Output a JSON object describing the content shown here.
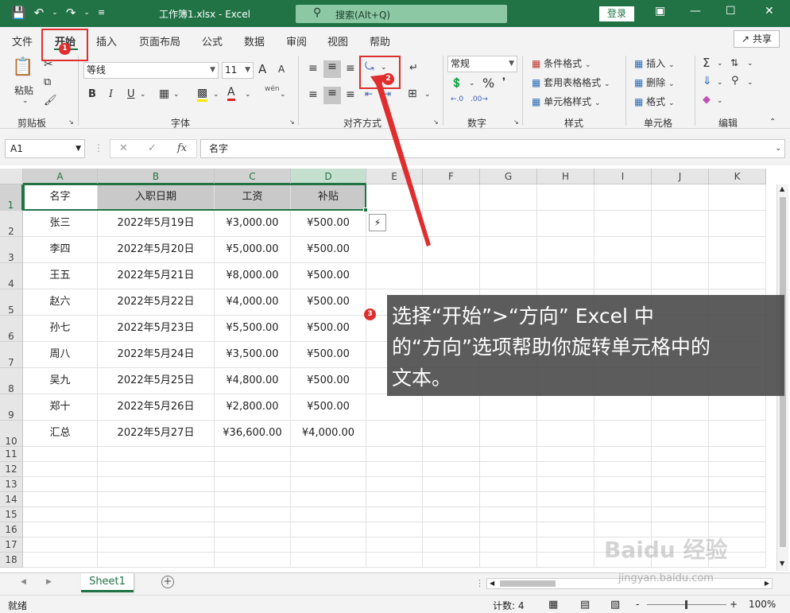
{
  "titlebar": {
    "title": "工作簿1.xlsx  -  Excel",
    "search_placeholder": "搜索(Alt+Q)",
    "login_label": "登录"
  },
  "menu": {
    "tabs": [
      "文件",
      "开始",
      "插入",
      "页面布局",
      "公式",
      "数据",
      "审阅",
      "视图",
      "帮助"
    ],
    "active_tab": "开始",
    "share_label": "共享"
  },
  "ribbon": {
    "clipboard": {
      "paste_label": "粘贴",
      "group_label": "剪贴板"
    },
    "font": {
      "font_name": "等线",
      "font_size": "11",
      "group_label": "字体",
      "bold": "B",
      "italic": "I",
      "underline": "U",
      "grow": "A",
      "shrink": "A",
      "phonetic": "wén"
    },
    "alignment": {
      "group_label": "对齐方式"
    },
    "number": {
      "format": "常规",
      "group_label": "数字"
    },
    "styles": {
      "cond_format": "条件格式",
      "table_format": "套用表格格式",
      "cell_styles": "单元格样式",
      "group_label": "样式"
    },
    "cells": {
      "insert": "插入",
      "delete": "删除",
      "format": "格式",
      "group_label": "单元格"
    },
    "editing": {
      "group_label": "编辑"
    }
  },
  "formula_bar": {
    "cell_ref": "A1",
    "fx_label": "fx",
    "content": "名字"
  },
  "grid": {
    "columns": [
      "A",
      "B",
      "C",
      "D",
      "E",
      "F",
      "G",
      "H",
      "I",
      "J",
      "K"
    ],
    "rows": [
      "1",
      "2",
      "3",
      "4",
      "5",
      "6",
      "7",
      "8",
      "9",
      "10",
      "11",
      "12",
      "13",
      "14",
      "15",
      "16",
      "17",
      "18"
    ],
    "headers": [
      "名字",
      "入职日期",
      "工资",
      "补贴"
    ],
    "data": [
      [
        "张三",
        "2022年5月19日",
        "¥3,000.00",
        "¥500.00"
      ],
      [
        "李四",
        "2022年5月20日",
        "¥5,000.00",
        "¥500.00"
      ],
      [
        "王五",
        "2022年5月21日",
        "¥8,000.00",
        "¥500.00"
      ],
      [
        "赵六",
        "2022年5月22日",
        "¥4,000.00",
        "¥500.00"
      ],
      [
        "孙七",
        "2022年5月23日",
        "¥5,500.00",
        "¥500.00"
      ],
      [
        "周八",
        "2022年5月24日",
        "¥3,500.00",
        "¥500.00"
      ],
      [
        "吴九",
        "2022年5月25日",
        "¥4,800.00",
        "¥500.00"
      ],
      [
        "郑十",
        "2022年5月26日",
        "¥2,800.00",
        "¥500.00"
      ],
      [
        "汇总",
        "2022年5月27日",
        "¥36,600.00",
        "¥4,000.00"
      ]
    ]
  },
  "annotations": {
    "badge1": "1",
    "badge2": "2",
    "badge3": "3",
    "callout_line1": "选择“开始”>“方向” Excel 中",
    "callout_line2": "的“方向”选项帮助你旋转单元格中的",
    "callout_line3": "文本。",
    "color": "#e02d2d"
  },
  "sheets": {
    "tabs": [
      "Sheet1"
    ],
    "add_label": "+"
  },
  "status": {
    "ready": "就绪",
    "count": "计数: 4",
    "zoom": "100%",
    "zoom_minus": "-",
    "zoom_plus": "+"
  },
  "watermark": {
    "brand": "Baidu 经验",
    "url": "jingyan.baidu.com"
  }
}
